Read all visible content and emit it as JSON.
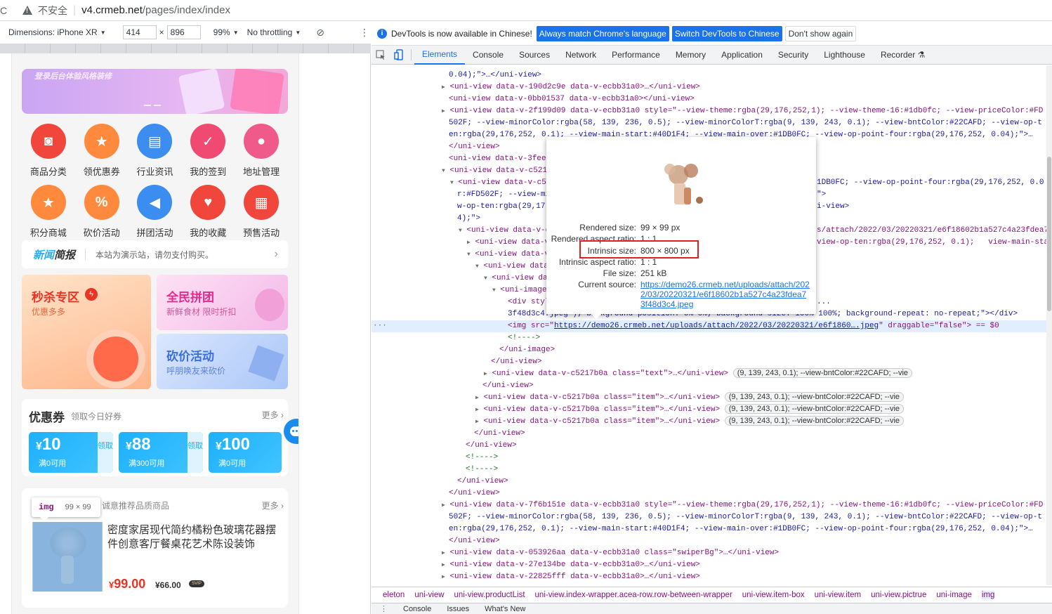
{
  "browser": {
    "insecure_label": "不安全",
    "url_host": "v4.crmeb.net",
    "url_path": "/pages/index/index"
  },
  "device_toolbar": {
    "device": "Dimensions: iPhone XR",
    "width": "414",
    "height": "896",
    "times": "×",
    "zoom": "99%",
    "throttling": "No throttling"
  },
  "phone": {
    "banner_text": "登录后台体验风格装修",
    "menu_row1": [
      {
        "label": "商品分类",
        "color": "#f0463b",
        "icon": "bag-icon"
      },
      {
        "label": "领优惠券",
        "color": "#ff8a3d",
        "icon": "ticket-icon"
      },
      {
        "label": "行业资讯",
        "color": "#3b8df0",
        "icon": "doc-icon"
      },
      {
        "label": "我的签到",
        "color": "#f04a73",
        "icon": "calendar-icon"
      },
      {
        "label": "地址管理",
        "color": "#f05a8a",
        "icon": "location-icon"
      }
    ],
    "menu_row2": [
      {
        "label": "积分商城",
        "color": "#ff8a3d",
        "icon": "store-icon"
      },
      {
        "label": "砍价活动",
        "color": "#ff8a3d",
        "icon": "percent-icon"
      },
      {
        "label": "拼团活动",
        "color": "#3b8df0",
        "icon": "megaphone-icon"
      },
      {
        "label": "我的收藏",
        "color": "#f0463b",
        "icon": "heart-icon"
      },
      {
        "label": "预售活动",
        "color": "#f0463b",
        "icon": "presale-icon"
      }
    ],
    "news": {
      "title_a": "新闻",
      "title_b": "简报",
      "message": "本站为演示站，请勿支付购买。"
    },
    "promos": {
      "seckill_title": "秒杀专区",
      "seckill_sub": "优惠多多",
      "group_title": "全民拼团",
      "group_sub": "新鲜食材 限时折扣",
      "bargain_title": "砍价活动",
      "bargain_sub": "呼朋唤友来砍价"
    },
    "coupons": {
      "title": "优惠券",
      "subtitle": "领取今日好券",
      "more": "更多 ›",
      "items": [
        {
          "currency": "¥",
          "amount": "10",
          "condition": "满0可用",
          "action": "领取"
        },
        {
          "currency": "¥",
          "amount": "88",
          "condition": "满300可用",
          "action": "领取"
        },
        {
          "currency": "¥",
          "amount": "100",
          "condition": "满0可用",
          "action": ""
        }
      ]
    },
    "recommend": {
      "subtitle": "诚意推荐品质商品",
      "more": "更多 ›",
      "product_name": "密度家居现代简约橘粉色玻璃花器摆件创意客厅餐桌花艺术陈设装饰",
      "price_symbol": "¥",
      "price": "99.00",
      "svip_price": "¥66.00",
      "svip_badge": "SVIP"
    },
    "img_tooltip": {
      "tag": "img",
      "size": "99 × 99"
    }
  },
  "devtools": {
    "info_message": "DevTools is now available in Chinese!",
    "btn_match": "Always match Chrome's language",
    "btn_switch": "Switch DevTools to Chinese",
    "btn_dismiss": "Don't show again",
    "tabs": [
      "Elements",
      "Console",
      "Sources",
      "Network",
      "Performance",
      "Memory",
      "Application",
      "Security",
      "Lighthouse",
      "Recorder"
    ],
    "active_tab": "Elements",
    "breadcrumbs": [
      "eleton",
      "uni-view",
      "uni-view.productList",
      "uni-view.index-wrapper.acea-row.row-between-wrapper",
      "uni-view.item-box",
      "uni-view.item",
      "uni-view.pictrue",
      "uni-image",
      "img"
    ],
    "drawer_tabs": [
      "Console",
      "Issues",
      "What's New"
    ],
    "popover": {
      "rendered_size_label": "Rendered size:",
      "rendered_size": "99 × 99 px",
      "rendered_ratio_label": "Rendered aspect ratio:",
      "rendered_ratio": "1 : 1",
      "intrinsic_size_label": "Intrinsic size:",
      "intrinsic_size": "800 × 800 px",
      "intrinsic_ratio_label": "Intrinsic aspect ratio:",
      "intrinsic_ratio": "1 : 1",
      "file_size_label": "File size:",
      "file_size": "251 kB",
      "source_label": "Current source:",
      "source": "https://demo26.crmeb.net/uploads/attach/2022/03/20220321/e6f18602b1a527c4a23fdea73f48d3c4.jpeg"
    },
    "code_lines": [
      "0.04);\">…</uni-view>",
      "<uni-view data-v-190d2c9e data-v-ecbb31a0>…</uni-view>",
      "<uni-view data-v-0bb01537 data-v-ecbb31a0></uni-view>",
      "<uni-view data-v-2f199d09 data-v-ecbb31a0 style=\"--view-theme:rgba(29,176,252,1); --view-theme-16:#1db0fc; --view-priceColor:#FD",
      "502F; --view-minorColor:rgba(58, 139, 236, 0.5); --view-minorColorT:rgba(9, 139, 243, 0.1); --view-bntColor:#22CAFD; --view-op-t",
      "en:rgba(29,176,252, 0.1); --view-main-start:#40D1F4; --view-main-over:#1DB0FC; --view-op-point-four:rgba(29,176,252, 0.04);\">…",
      "</uni-view>",
      "<uni-view data-v-3fee",
      "<uni-view data-v-c521",
      "<uni-view data-v-c52",
      "r:#FD502F; --view-mi",
      "w-op-ten:rgba(29,17",
      "4);\">",
      "<uni-view data-v-c",
      "<uni-view data-v",
      "<uni-view data-v",
      "<uni-view data",
      "<uni-view da",
      "<uni-image",
      "<div styl",
      "3f48d3c4.jpeg\"); background-position: 0% 0%; background-size: 100% 100%; background-repeat: no-repeat;\"></div>",
      "<img src=\"",
      "https://demo26.crmeb.net/uploads/attach/2022/03/20220321/e6f1860….jpeg",
      "\" draggable=\"false\"> == $0",
      "<!---->",
      "</uni-image>",
      "</uni-view>",
      "<uni-view data-v-c5217b0a class=\"text\">…</uni-view>",
      "</uni-view>",
      "<uni-view data-v-c5217b0a class=\"item\">…</uni-view>",
      "<uni-view data-v-c5217b0a class=\"item\">…</uni-view>",
      "<uni-view data-v-c5217b0a class=\"item\">…</uni-view>",
      "</uni-view>",
      "</uni-view>",
      "<!---->",
      "<!---->",
      "</uni-view>",
      "</uni-view>",
      "<uni-view data-v-7f6b151e data-v-ecbb31a0 style=\"--view-theme:rgba(29,176,252,1); --view-theme-16:#1db0fc; --view-priceColor:#FD",
      "502F; --view-minorColor:rgba(58, 139, 236, 0.5); --view-minorColorT:rgba(9, 139, 243, 0.1); --view-bntColor:#22CAFD; --view-op-t",
      "en:rgba(29,176,252, 0.1); --view-main-start:#40D1F4; --view-main-over:#1DB0FC; --view-op-point-four:rgba(29,176,252, 0.04);\">…",
      "</uni-view>",
      "<uni-view data-v-053926aa data-v-ecbb31a0 class=\"swiperBg\">…</uni-view>",
      "<uni-view data-v-27e134be data-v-ecbb31a0>…</uni-view>",
      "<uni-view data-v-22825fff data-v-ecbb31a0>…</uni-view>",
      "flex",
      ",252,1); --view-theme-16:#1db0fc; --view-priceColo",
      "(9, 139, 243, 0.1); --view-bntColor:#22CAFD; --vie",
      "1DB0FC; --view-op-point-four:rgba(29,176,252, 0.0",
      "\">",
      "i-view>",
      "s/attach/2022/03/20220321/e6f18602b1a527c4a23fdea7",
      "view-op-ten:rgba(29,176,252, 0.1);   view-main-start:#40D1F4;   view-main-over:#1DB0FC;   view-op-point-four:rgba(29,176,252,",
      "..."
    ]
  }
}
